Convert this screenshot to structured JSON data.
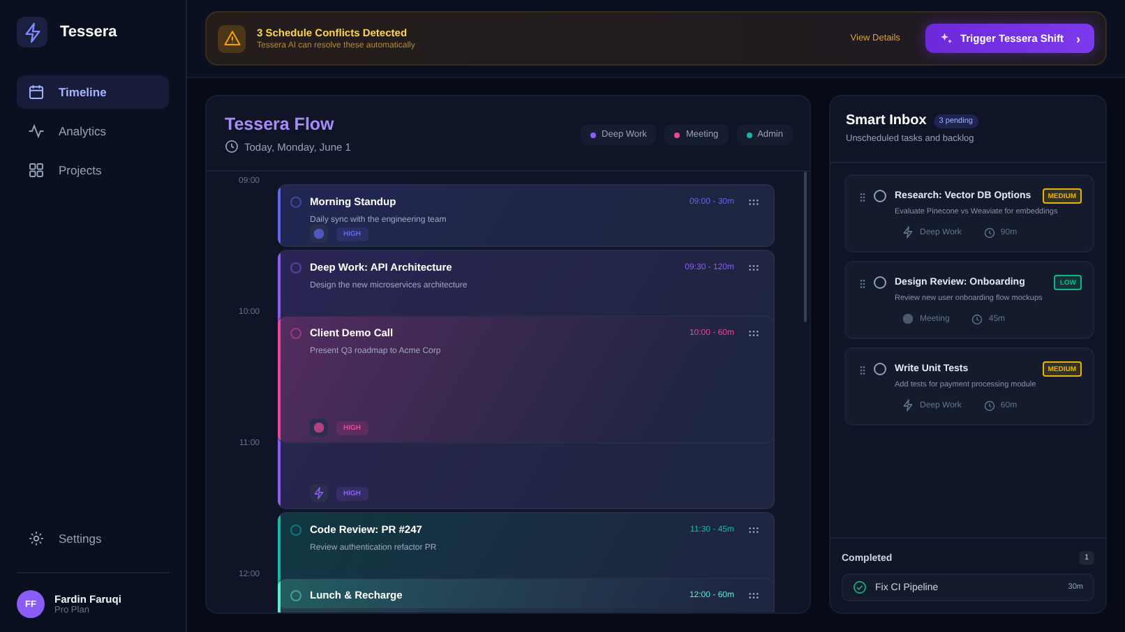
{
  "brand": {
    "name": "Tessera"
  },
  "nav": [
    {
      "label": "Timeline",
      "selected": true
    },
    {
      "label": "Analytics",
      "selected": false
    },
    {
      "label": "Projects",
      "selected": false
    }
  ],
  "settings": {
    "label": "Settings"
  },
  "user": {
    "initials": "FF",
    "name": "Fardin Faruqi",
    "plan": "Pro Plan"
  },
  "alert": {
    "title": "3 Schedule Conflicts Detected",
    "subtitle": "Tessera AI can resolve these automatically",
    "link": "View Details",
    "button": "Trigger Tessera Shift",
    "chevron": "›"
  },
  "timeline": {
    "title": "Tessera Flow",
    "date": "Today, Monday, June 1",
    "legend": [
      {
        "label": "Deep Work",
        "color": "#8b5cf6"
      },
      {
        "label": "Meeting",
        "color": "#ec4899"
      },
      {
        "label": "Admin",
        "color": "#14b8a6"
      }
    ],
    "hours": [
      "09:00",
      "10:00",
      "11:00",
      "12:00"
    ],
    "events": [
      {
        "title": "Morning Standup",
        "description": "Daily sync with the engineering team",
        "time": "09:00 - 30m",
        "color": "#6366f1",
        "badge": {
          "kind": "dot",
          "text": "HIGH"
        }
      },
      {
        "title": "Deep Work: API Architecture",
        "description": "Design the new microservices architecture",
        "time": "09:30 - 120m",
        "color": "#8b5cf6",
        "badge": {
          "kind": "bolt",
          "text": "HIGH"
        }
      },
      {
        "title": "Client Demo Call",
        "description": "Present Q3 roadmap to Acme Corp",
        "time": "10:00 - 60m",
        "color": "#ec4899",
        "badge": {
          "kind": "dot",
          "text": "HIGH"
        }
      },
      {
        "title": "Code Review: PR #247",
        "description": "Review authentication refactor PR",
        "time": "11:30 - 45m",
        "color": "#14b8a6"
      },
      {
        "title": "Lunch & Recharge",
        "time": "12:00 - 60m",
        "color": "#5eead4"
      }
    ]
  },
  "inbox": {
    "title": "Smart Inbox",
    "count": "3 pending",
    "subtitle": "Unscheduled tasks and backlog",
    "tasks": [
      {
        "title": "Research: Vector DB Options",
        "description": "Evaluate Pinecone vs Weaviate for embeddings",
        "priority": "MEDIUM",
        "color": "#eab308",
        "category": "Deep Work",
        "kind": "bolt",
        "duration": "90m"
      },
      {
        "title": "Design Review: Onboarding",
        "description": "Review new user onboarding flow mockups",
        "priority": "LOW",
        "color": "#10b981",
        "category": "Meeting",
        "kind": "dot",
        "duration": "45m"
      },
      {
        "title": "Write Unit Tests",
        "description": "Add tests for payment processing module",
        "priority": "MEDIUM",
        "color": "#eab308",
        "category": "Deep Work",
        "kind": "bolt",
        "duration": "60m"
      }
    ],
    "completed": {
      "label": "Completed",
      "count": "1",
      "items": [
        {
          "title": "Fix CI Pipeline",
          "duration": "30m",
          "checked": true
        }
      ]
    }
  }
}
